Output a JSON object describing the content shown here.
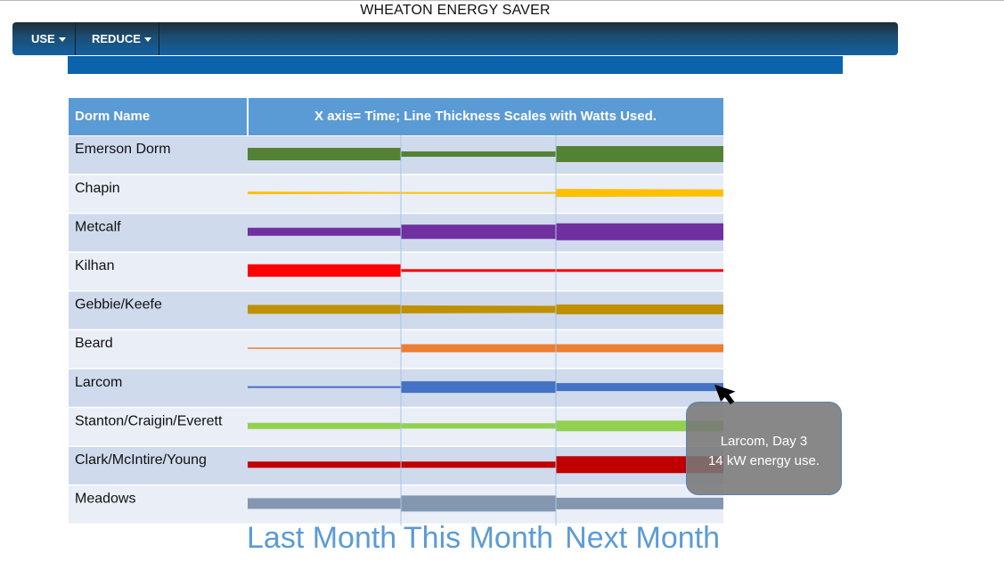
{
  "app": {
    "title": "WHEATON ENERGY SAVER"
  },
  "nav": {
    "items": [
      {
        "label": "USE"
      },
      {
        "label": "REDUCE"
      }
    ]
  },
  "table": {
    "header": {
      "name_col": "Dorm Name",
      "chart_col": "X axis= Time; Line Thickness Scales with Watts Used."
    }
  },
  "chart_data": {
    "type": "line",
    "encoding": "line thickness",
    "periods": [
      "Last Month",
      "This Month",
      "Next Month"
    ],
    "series": [
      {
        "name": "Emerson Dorm",
        "color": "#548235",
        "values": [
          14,
          14,
          6,
          6,
          18,
          18
        ]
      },
      {
        "name": "Chapin",
        "color": "#ffc000",
        "values": [
          3,
          2,
          2,
          2,
          9,
          8
        ]
      },
      {
        "name": "Metcalf",
        "color": "#7030a0",
        "values": [
          9,
          9,
          16,
          16,
          19,
          19
        ]
      },
      {
        "name": "Kilhan",
        "color": "#ff0000",
        "values": [
          14,
          14,
          3,
          3,
          3,
          3
        ]
      },
      {
        "name": "Gebbie/Keefe",
        "color": "#bf9000",
        "values": [
          10,
          10,
          9,
          8,
          11,
          11
        ]
      },
      {
        "name": "Beard",
        "color": "#ed7d31",
        "values": [
          1.5,
          1.5,
          9,
          9,
          9,
          9
        ]
      },
      {
        "name": "Larcom",
        "color": "#4472c4",
        "values": [
          2,
          2,
          13,
          13,
          9,
          9
        ]
      },
      {
        "name": "Stanton/Craigin/Everett",
        "color": "#92d050",
        "values": [
          7,
          7,
          6,
          6,
          12,
          12
        ]
      },
      {
        "name": "Clark/McIntire/Young",
        "color": "#c00000",
        "values": [
          7,
          7,
          7,
          7,
          19,
          19
        ]
      },
      {
        "name": "Meadows",
        "color": "#8497b0",
        "values": [
          12,
          12,
          18,
          18,
          13,
          13
        ]
      }
    ]
  },
  "tooltip": {
    "line1": "Larcom, Day 3",
    "line2": "14 kW energy use."
  },
  "colors": {
    "header_bg": "#5b9bd5",
    "row_dark": "#cfdaed",
    "row_light": "#e9eef7",
    "nav_accent": "#0b63ac"
  },
  "icons": {
    "cursor": "arrow-cursor-icon",
    "dropdown": "caret-down-icon"
  }
}
